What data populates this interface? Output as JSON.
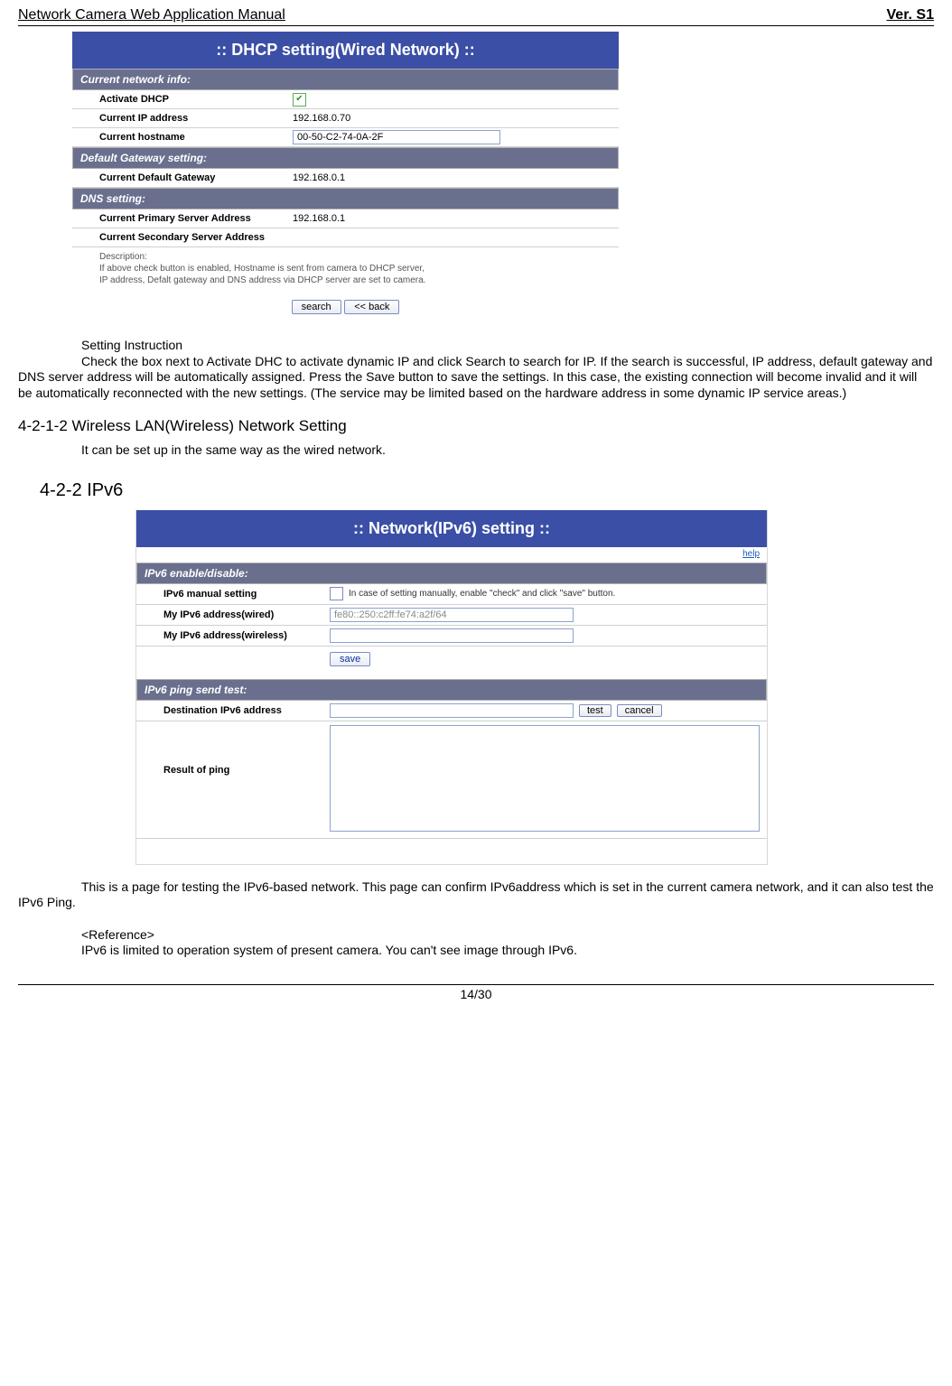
{
  "header": {
    "title": "Network Camera Web Application Manual",
    "version": "Ver. S1"
  },
  "dhcp_panel": {
    "title": ":: DHCP setting(Wired Network) ::",
    "section1": "Current network info:",
    "row_activate_label": "Activate DHCP",
    "row_activate_checked": true,
    "row_ip_label": "Current IP address",
    "row_ip_value": "192.168.0.70",
    "row_host_label": "Current hostname",
    "row_host_value": "00-50-C2-74-0A-2F",
    "section2": "Default Gateway setting:",
    "row_gw_label": "Current Default Gateway",
    "row_gw_value": "192.168.0.1",
    "section3": "DNS setting:",
    "row_dns1_label": "Current Primary Server Address",
    "row_dns1_value": "192.168.0.1",
    "row_dns2_label": "Current Secondary Server Address",
    "row_dns2_value": "",
    "desc_label": "Description:",
    "desc_line1": "If above check button is enabled, Hostname is sent from camera to DHCP server,",
    "desc_line2": "IP address, Defalt gateway and DNS address via DHCP server are set to camera.",
    "btn_search": "search",
    "btn_back": "<< back"
  },
  "body1": {
    "heading": "Setting Instruction",
    "para": "Check the box next to Activate DHC to activate dynamic IP and click Search to search for IP. If the search is successful, IP address, default gateway and DNS server address will be automatically assigned. Press the Save button to save the settings. In this case, the existing connection will become invalid and it will be automatically reconnected with the new settings. (The service may be limited based on the hardware address in some dynamic IP service areas.)"
  },
  "h3_1": "4-2-1-2 Wireless LAN(Wireless) Network Setting",
  "body2": "It can be set up in the same way as the wired network.",
  "h2_1": "4-2-2 IPv6",
  "ipv6_panel": {
    "title": ":: Network(IPv6) setting ::",
    "help": "help",
    "section1": "IPv6 enable/disable:",
    "row_manual_label": "IPv6 manual setting",
    "row_manual_hint": "In case of setting manually, enable \"check\" and click \"save\" button.",
    "row_addr_wired_label": "My IPv6 address(wired)",
    "row_addr_wired_value": "fe80::250:c2ff:fe74:a2f/64",
    "row_addr_wireless_label": "My IPv6 address(wireless)",
    "row_addr_wireless_value": "",
    "btn_save": "save",
    "section2": "IPv6 ping send test:",
    "row_dest_label": "Destination IPv6 address",
    "btn_test": "test",
    "btn_cancel": "cancel",
    "row_result_label": "Result of ping"
  },
  "body3": "This is a page for testing the IPv6-based network. This page can confirm IPv6address which is set in the current camera network, and it can also test the IPv6 Ping.",
  "ref_label": "<Reference>",
  "ref_text": "IPv6 is limited to operation system of present camera. You can't see image through IPv6.",
  "footer": "14/30"
}
